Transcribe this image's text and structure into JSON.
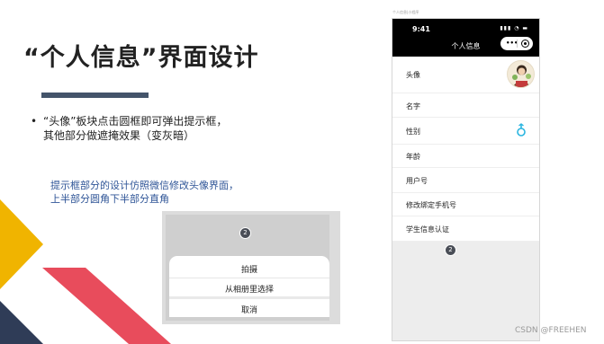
{
  "slide": {
    "title": "“个人信息”界面设计",
    "bullet_marker": "•",
    "bullet_line1": "“头像”板块点击圆框即可弹出提示框，",
    "bullet_line2": "其他部分做遮掩效果（变灰暗）",
    "note_line1": "提示框部分的设计仿照微信修改头像界面，",
    "note_line2": "上半部分圆角下半部分直角"
  },
  "modal": {
    "badge": "2",
    "options": [
      "拍摄",
      "从相册里选择"
    ],
    "cancel_label": "取消"
  },
  "phone": {
    "caption": "个人信息|小程序",
    "status_time": "9:41",
    "status_icons": "▮▮▮ ◔ ▬",
    "nav_title": "个人信息",
    "capsule_dots": "•••",
    "rows": [
      {
        "label": "头像"
      },
      {
        "label": "名字"
      },
      {
        "label": "性别"
      },
      {
        "label": "年龄"
      },
      {
        "label": "用户号"
      },
      {
        "label": "修改绑定手机号"
      },
      {
        "label": "学生信息认证"
      }
    ],
    "badge": "2"
  },
  "watermark": "CSDN @FREEHEN",
  "colors": {
    "accent_bar": "#44546a",
    "note_text": "#2f5597",
    "deco_yellow": "#f0b400",
    "deco_red": "#e84c5c",
    "deco_navy": "#2f3c57",
    "gender_icon": "#2ab5e0"
  }
}
